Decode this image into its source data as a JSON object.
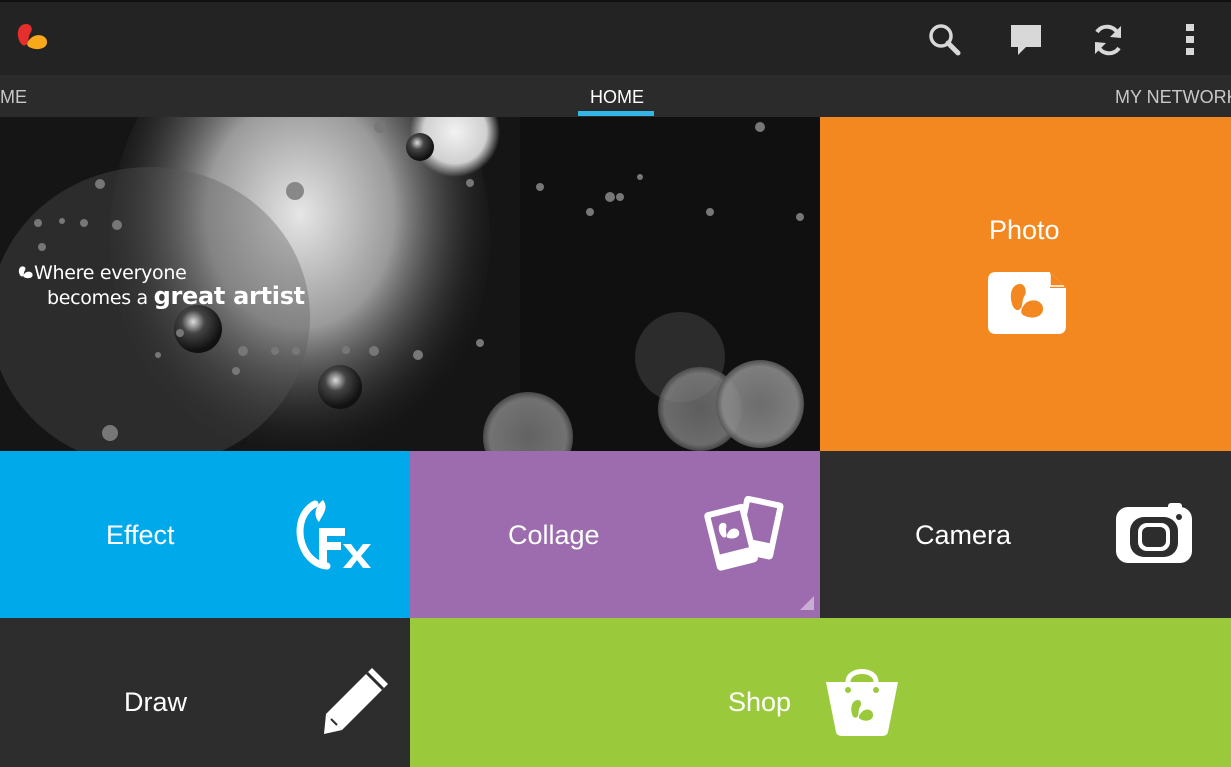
{
  "app": {
    "logo_icon": "picsart-logo-icon"
  },
  "toolbar": {
    "actions": [
      {
        "icon": "search-icon"
      },
      {
        "icon": "chat-icon"
      },
      {
        "icon": "sync-icon"
      },
      {
        "icon": "overflow-menu-icon"
      }
    ]
  },
  "tabs": {
    "left": "ME",
    "active": "HOME",
    "right": "MY NETWORK",
    "accent": "#33b5e5"
  },
  "hero": {
    "line1": "Where everyone",
    "line2_prefix": "becomes a ",
    "line2_bold": "great artist"
  },
  "tiles": {
    "photo": {
      "label": "Photo",
      "color": "#f38820",
      "icon": "photo-icon"
    },
    "effect": {
      "label": "Effect",
      "color": "#00aaea",
      "icon": "fx-icon"
    },
    "collage": {
      "label": "Collage",
      "color": "#9c6cae",
      "icon": "collage-icon"
    },
    "camera": {
      "label": "Camera",
      "color": "#2d2d2d",
      "icon": "camera-icon"
    },
    "draw": {
      "label": "Draw",
      "color": "#2d2d2d",
      "icon": "pencil-icon"
    },
    "shop": {
      "label": "Shop",
      "color": "#9aca3c",
      "icon": "shopping-bag-icon"
    }
  }
}
